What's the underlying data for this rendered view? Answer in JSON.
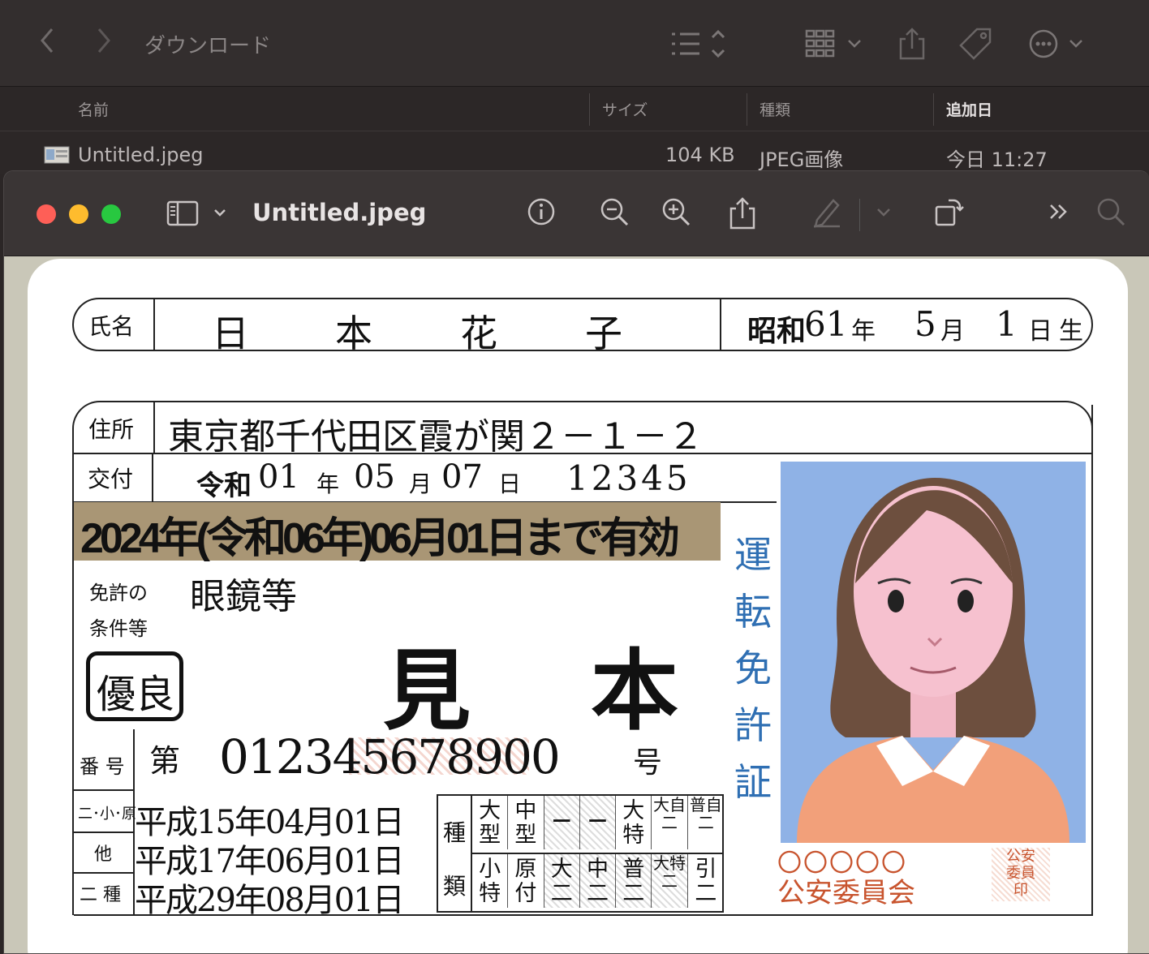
{
  "finder": {
    "title": "ダウンロード",
    "columns": {
      "name": "名前",
      "size": "サイズ",
      "kind": "種類",
      "date_added": "追加日"
    },
    "file": {
      "name": "Untitled.jpeg",
      "size": "104 KB",
      "kind": "JPEG画像",
      "date_added": "今日 11:27"
    }
  },
  "preview": {
    "title": "Untitled.jpeg"
  },
  "card": {
    "name_label": "氏名",
    "name_chars": [
      "日",
      "本",
      "花",
      "子"
    ],
    "birth": {
      "era": "昭和",
      "year": "61",
      "year_unit": "年",
      "month": "5",
      "month_unit": "月",
      "day": "1",
      "day_unit": "日",
      "suffix": "生"
    },
    "address_label": "住所",
    "address": "東京都千代田区霞が関２－１－２",
    "issue_label": "交付",
    "issue": {
      "era": "令和",
      "year": "01",
      "y": "年",
      "month": "05",
      "m": "月",
      "day": "07",
      "d": "日",
      "number": "12345"
    },
    "expiry": "2024年(令和06年)06月01日まで有効",
    "conditions_label_1": "免許の",
    "conditions_label_2": "条件等",
    "conditions": "眼鏡等",
    "sample": "見　本",
    "excellent_badge": "優良",
    "number_label": "番 号",
    "number_prefix": "第",
    "license_number": "012345678900",
    "number_suffix": "号",
    "vertical_title": [
      "運",
      "転",
      "免",
      "許",
      "証"
    ],
    "history": [
      {
        "label": "二･小･原",
        "date": "平成15年04月01日"
      },
      {
        "label": "他",
        "date": "平成17年06月01日"
      },
      {
        "label": "二 種",
        "date": "平成29年08月01日"
      }
    ],
    "category_label_top": "種",
    "category_label_bottom": "類",
    "categories_top": [
      "大型",
      "中型",
      "－",
      "－",
      "大特",
      "大自二",
      "普自二"
    ],
    "categories_bottom": [
      "小特",
      "原付",
      "大二",
      "中二",
      "普二",
      "大特二",
      "引二"
    ],
    "commission": "公安委員会",
    "commission_circles": "〇〇〇〇〇",
    "seal": [
      "公安",
      "委員",
      "印"
    ]
  },
  "colors": {
    "expiry_band": "#a99675",
    "title_blue": "#2f6fb3",
    "seal_red": "#c8542e",
    "photo_bg": "#8fb2e6"
  },
  "icons": [
    "chevron-left-icon",
    "chevron-right-icon",
    "list-view-icon",
    "gallery-view-icon",
    "share-icon",
    "tag-icon",
    "more-icon",
    "sidebar-icon",
    "info-icon",
    "zoom-out-icon",
    "zoom-in-icon",
    "markup-icon",
    "rotate-icon",
    "search-icon"
  ]
}
